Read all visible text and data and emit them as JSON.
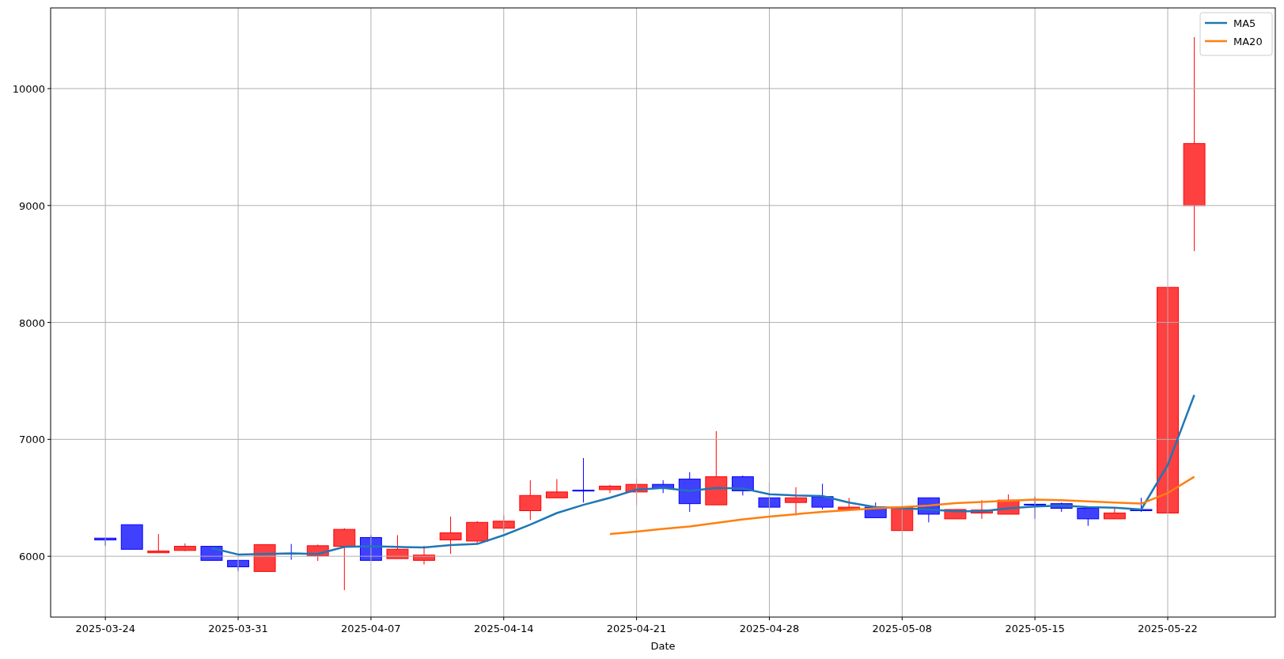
{
  "chart": {
    "chart_data": {
      "type": "line",
      "xlabel": "Date",
      "categories": [
        "2025-03-24",
        null,
        null,
        null,
        null,
        "2025-03-31",
        null,
        null,
        null,
        null,
        "2025-04-07",
        null,
        null,
        null,
        null,
        "2025-04-14",
        null,
        null,
        null,
        null,
        "2025-04-21",
        null,
        null,
        null,
        null,
        "2025-04-28",
        null,
        null,
        null,
        null,
        "2025-05-08",
        null,
        null,
        null,
        null,
        "2025-05-15",
        null,
        null,
        null,
        null,
        "2025-05-22",
        null
      ],
      "ylim": [
        5480,
        10690
      ],
      "yticks": [
        6000,
        7000,
        8000,
        9000,
        10000
      ],
      "grid": true,
      "legend": true,
      "series": [
        {
          "name": "MA5",
          "color": "#1f77b4",
          "values": [
            null,
            null,
            null,
            null,
            6070,
            6015,
            6020,
            6025,
            6020,
            6080,
            6085,
            6080,
            6075,
            6095,
            6105,
            6180,
            6270,
            6370,
            6440,
            6500,
            6570,
            6585,
            6560,
            6585,
            6580,
            6530,
            6520,
            6515,
            6460,
            6420,
            6410,
            6400,
            6385,
            6385,
            6410,
            6425,
            6435,
            6420,
            6415,
            6400,
            6780,
            7380
          ]
        },
        {
          "name": "MA20",
          "color": "#ff7f0e",
          "values": [
            null,
            null,
            null,
            null,
            null,
            null,
            null,
            null,
            null,
            null,
            null,
            null,
            null,
            null,
            null,
            null,
            null,
            null,
            null,
            6190,
            6210,
            6235,
            6255,
            6285,
            6315,
            6340,
            6360,
            6380,
            6395,
            6410,
            6420,
            6435,
            6455,
            6465,
            6475,
            6485,
            6480,
            6470,
            6460,
            6450,
            6540,
            6680
          ]
        }
      ]
    }
  }
}
